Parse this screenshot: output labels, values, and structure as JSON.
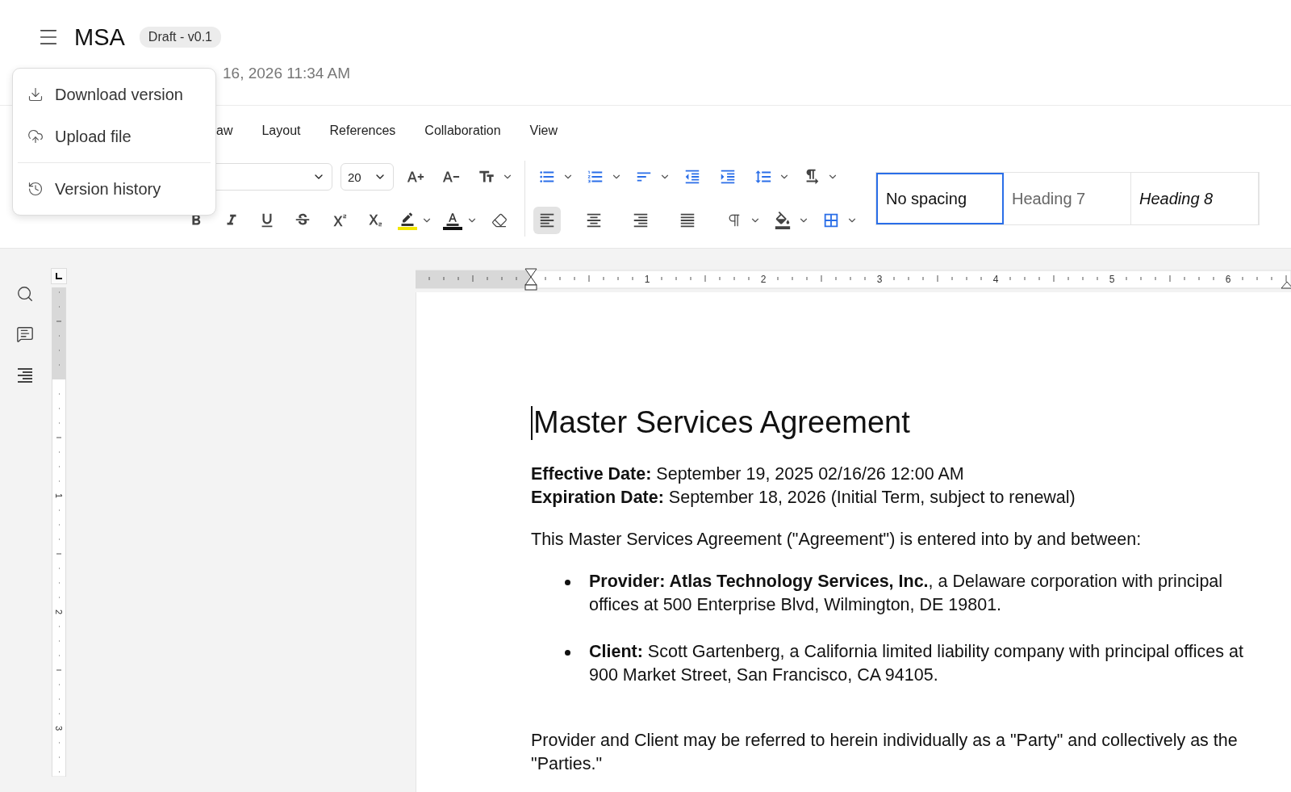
{
  "header": {
    "title": "MSA",
    "badge": "Draft - v0.1",
    "subtitle": "16, 2026 11:34 AM"
  },
  "file_menu": {
    "groups": [
      [
        {
          "label": "Download version",
          "kind": "download"
        },
        {
          "label": "Upload file",
          "kind": "upload"
        }
      ],
      [
        {
          "label": "Version history",
          "kind": "history"
        }
      ]
    ]
  },
  "menu_tabs": [
    {
      "label": "aw",
      "selected": false
    },
    {
      "label": "Layout",
      "selected": false
    },
    {
      "label": "References",
      "selected": false
    },
    {
      "label": "Collaboration",
      "selected": false
    },
    {
      "label": "View",
      "selected": false
    }
  ],
  "toolbar": {
    "font_size": "20",
    "alignment": [
      {
        "kind": "left",
        "selected": true
      },
      {
        "kind": "center",
        "selected": false
      },
      {
        "kind": "right",
        "selected": false
      },
      {
        "kind": "justify",
        "selected": false
      }
    ],
    "styles": [
      {
        "label": "No spacing",
        "kind": "plain",
        "selected": true
      },
      {
        "label": "Heading 7",
        "kind": "heading",
        "selected": false
      },
      {
        "label": "Heading 8",
        "kind": "italic",
        "selected": false
      }
    ]
  },
  "ruler": {
    "horizontal": [
      "1",
      "2",
      "3",
      "4",
      "5",
      "6"
    ],
    "vertical": [
      "1",
      "2",
      "3"
    ]
  },
  "document": {
    "title": "Master Services Agreement",
    "blocks": [
      {
        "kind": "lines",
        "lines": [
          "**Effective Date:** September 19, 2025 02/16/26 12:00 AM",
          "**Expiration Date:** September 18, 2026 (Initial Term, subject to renewal)"
        ]
      },
      {
        "kind": "paragraph",
        "text": "This Master Services Agreement (\"Agreement\") is entered into by and between:"
      },
      {
        "kind": "bullets",
        "items": [
          "**Provider: Atlas Technology Services, Inc.**, a Delaware corporation with principal offices at 500 Enterprise Blvd, Wilmington, DE 19801.",
          "**Client:** Scott Gartenberg, a California limited liability company with principal offices at 900 Market Street, San Francisco, CA 94105."
        ]
      },
      {
        "kind": "paragraph",
        "text": "Provider and Client may be referred to herein individually as a \"Party\" and collectively as the \"Parties.\""
      }
    ]
  }
}
